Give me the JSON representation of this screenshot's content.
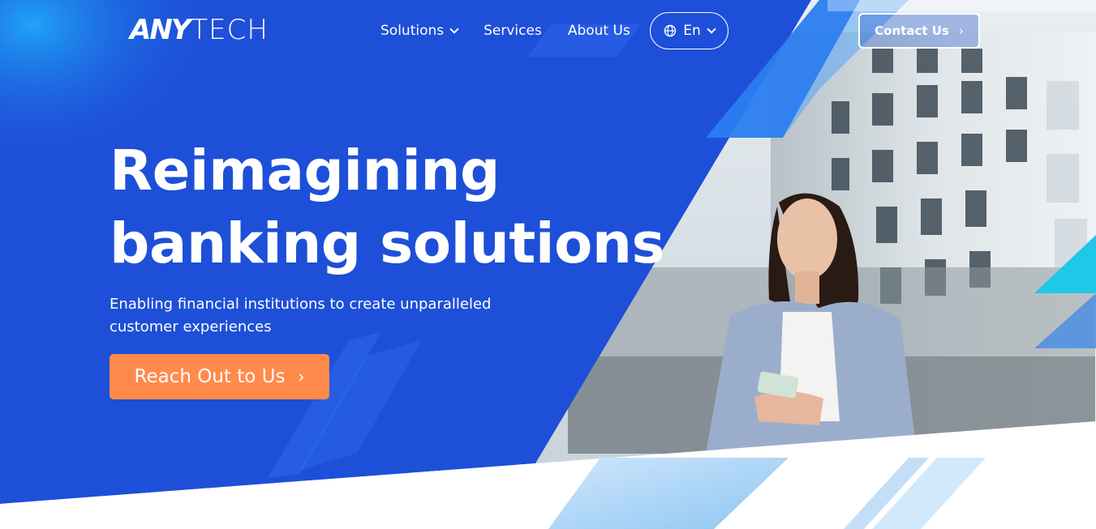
{
  "header": {
    "logo_bold": "AN",
    "logo_light": "TECH",
    "nav": [
      {
        "label": "Solutions",
        "has_dropdown": true
      },
      {
        "label": "Services",
        "has_dropdown": false
      },
      {
        "label": "About Us",
        "has_dropdown": false
      }
    ],
    "language": {
      "label": "En",
      "icon": "globe-icon"
    },
    "contact_label": "Contact Us",
    "contact_arrow": "›"
  },
  "hero": {
    "headline_line1": "Reimagining",
    "headline_line2": "banking solutions",
    "subtext": "Enabling financial institutions to create unparalleled customer experiences",
    "cta_label": "Reach Out to Us",
    "cta_arrow": "›"
  },
  "colors": {
    "primary_blue": "#1e4fd8",
    "accent_orange": "#ff8a4c",
    "accent_cyan": "#1ec8e6",
    "white": "#ffffff"
  }
}
